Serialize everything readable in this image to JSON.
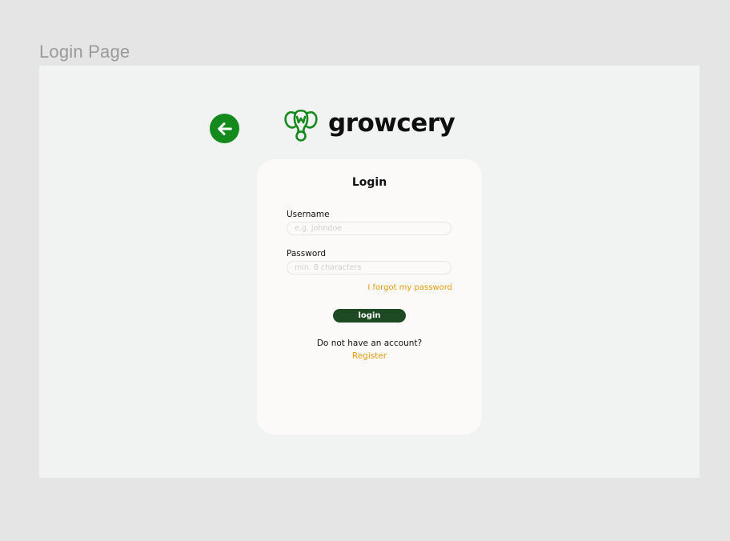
{
  "frame": {
    "label": "Login Page"
  },
  "header": {
    "back_icon": "arrow-left-icon",
    "logo_icon": "elephant-logo-icon",
    "brand_name": "growcery"
  },
  "login_card": {
    "title": "Login",
    "username": {
      "label": "Username",
      "placeholder": "e.g. johndoe",
      "value": ""
    },
    "password": {
      "label": "Password",
      "placeholder": "min. 8 characters",
      "value": ""
    },
    "forgot_password_link": "I forgot my password",
    "login_button": "login",
    "no_account_text": "Do not have an account?",
    "register_link": "Register"
  },
  "colors": {
    "brand_green": "#138a1b",
    "button_dark_green": "#1d4a22",
    "link_orange": "#e69a12",
    "canvas": "#e5e5e5",
    "frame_bg": "#f1f2f2",
    "card_bg": "#fbfaf8"
  }
}
